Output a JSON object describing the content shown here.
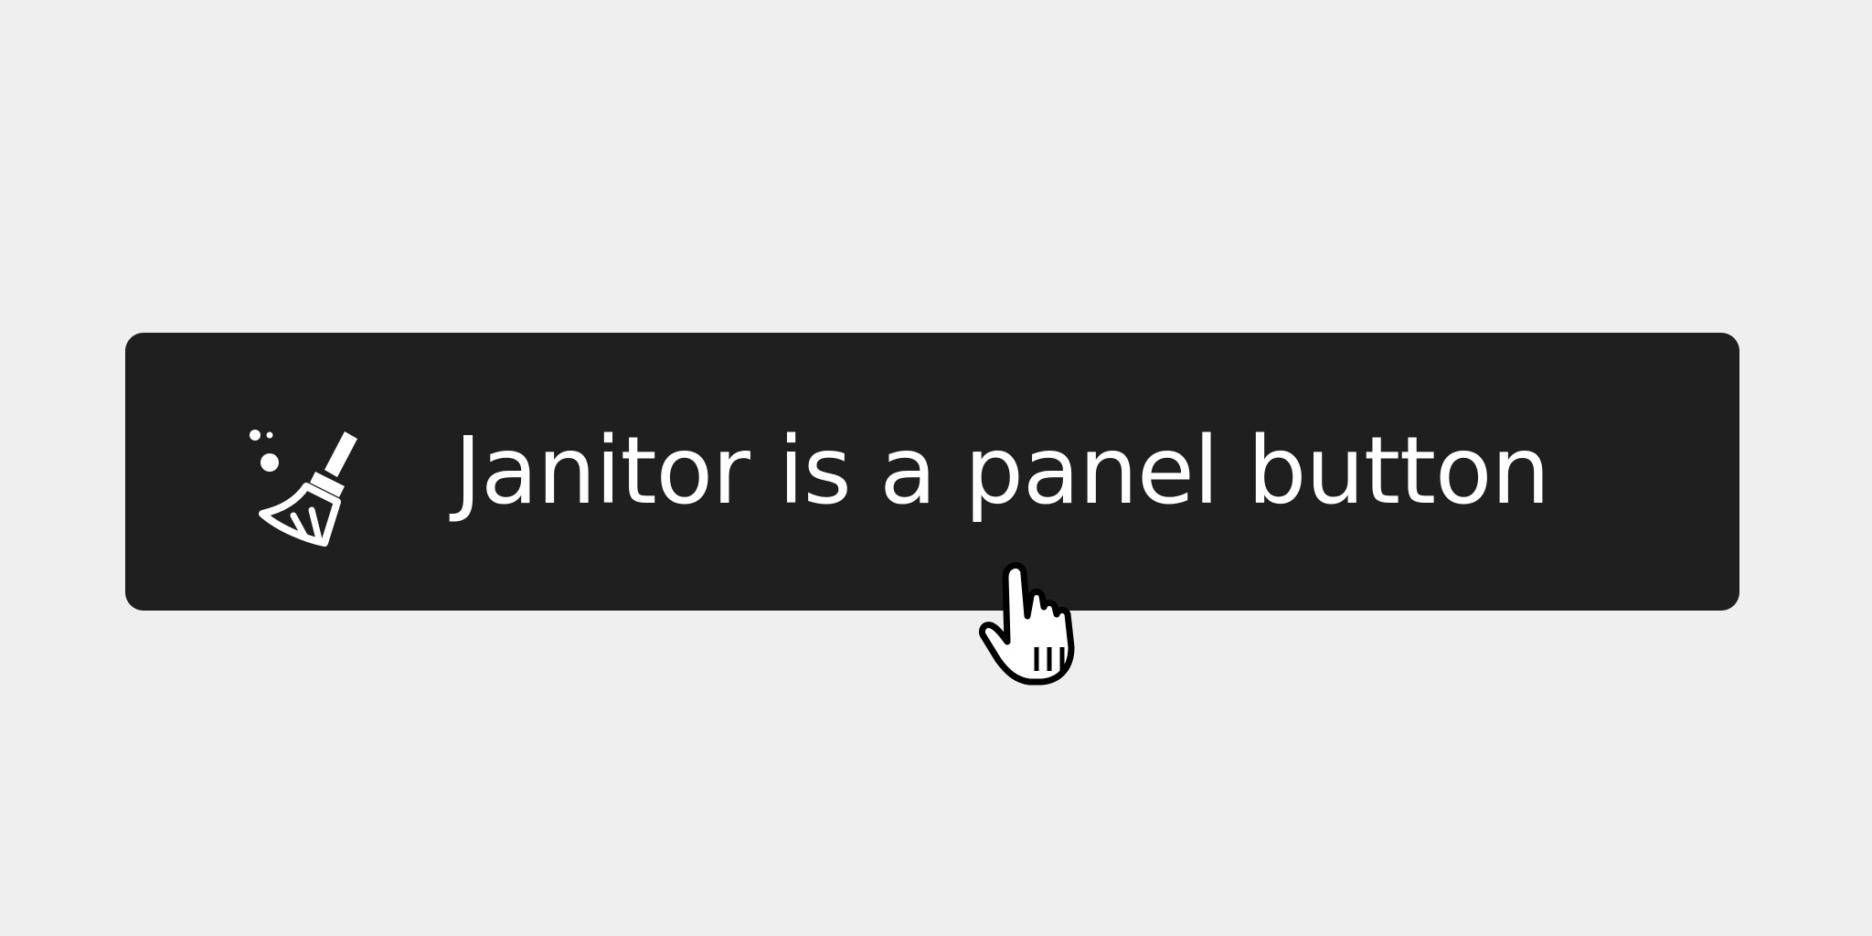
{
  "button": {
    "label": "Janitor is a panel button",
    "icon": "broom-sparkles-icon",
    "background_color": "#1f1f1f",
    "text_color": "#ffffff"
  },
  "page": {
    "background_color": "#efefef"
  },
  "cursor": {
    "icon": "pointer-hand-cursor-icon"
  }
}
